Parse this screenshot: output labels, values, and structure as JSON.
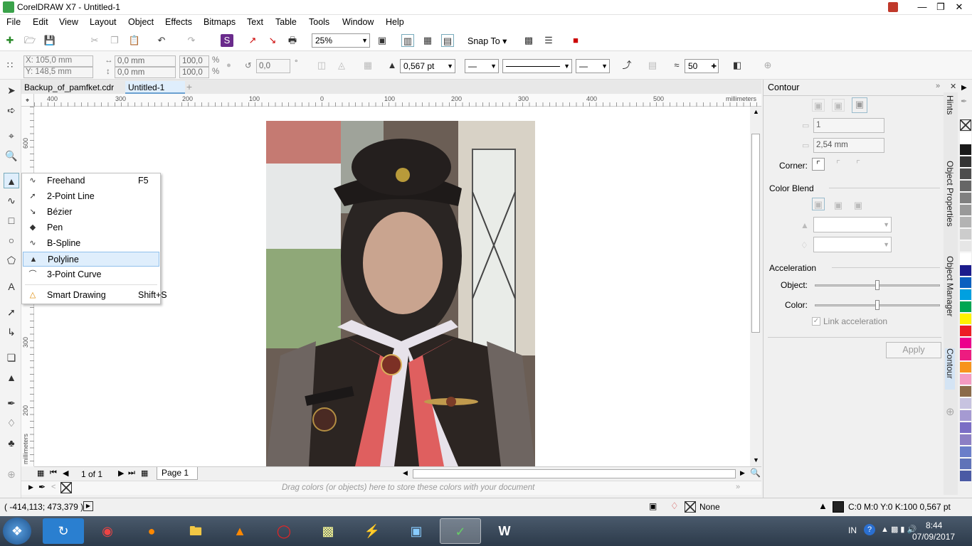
{
  "window": {
    "title": "CorelDRAW X7 - Untitled-1"
  },
  "menu": [
    "File",
    "Edit",
    "View",
    "Layout",
    "Object",
    "Effects",
    "Bitmaps",
    "Text",
    "Table",
    "Tools",
    "Window",
    "Help"
  ],
  "toolbar": {
    "zoom": "25%",
    "snap_to": "Snap To"
  },
  "props": {
    "x": "X: 105,0 mm",
    "y": "Y: 148,5 mm",
    "w": "0,0 mm",
    "h": "0,0 mm",
    "sx": "100,0",
    "sy": "100,0",
    "pct": "%",
    "angle": "0,0",
    "deg": "°",
    "outline_width": "0,567 pt",
    "smoothing": "50"
  },
  "doc_tabs": [
    "Backup_of_pamfket.cdr",
    "Untitled-1"
  ],
  "ruler": {
    "h_ticks": [
      "400",
      "300",
      "200",
      "100",
      "0",
      "100",
      "200",
      "300",
      "400",
      "500"
    ],
    "h_units": "millimeters",
    "v_ticks": [
      "600",
      "300",
      "200"
    ],
    "v_units": "millimeters"
  },
  "flyout": [
    {
      "label": "Freehand",
      "shortcut": "F5",
      "icon": "freehand-icon"
    },
    {
      "label": "2-Point Line",
      "shortcut": "",
      "icon": "two-point-line-icon"
    },
    {
      "label": "Bézier",
      "shortcut": "",
      "icon": "bezier-icon"
    },
    {
      "label": "Pen",
      "shortcut": "",
      "icon": "pen-icon"
    },
    {
      "label": "B-Spline",
      "shortcut": "",
      "icon": "bspline-icon"
    },
    {
      "label": "Polyline",
      "shortcut": "",
      "icon": "polyline-icon"
    },
    {
      "label": "3-Point Curve",
      "shortcut": "",
      "icon": "three-point-curve-icon"
    },
    {
      "label": "Smart Drawing",
      "shortcut": "Shift+S",
      "icon": "smart-drawing-icon"
    }
  ],
  "pagebar": {
    "page_count": "1 of 1",
    "page_tab": "Page 1"
  },
  "colorbar": {
    "hint": "Drag colors (or objects) here to store these colors with your document"
  },
  "docker": {
    "title": "Contour",
    "steps": "1",
    "offset": "2,54 mm",
    "corner_label": "Corner:",
    "color_blend_label": "Color Blend",
    "acceleration_label": "Acceleration",
    "object_label": "Object:",
    "color_label": "Color:",
    "object_accel": 0.5,
    "color_accel": 0.5,
    "link_accel": "Link acceleration",
    "apply": "Apply"
  },
  "docker_tabs": [
    "Hints",
    "Object Properties",
    "Object Manager",
    "Contour"
  ],
  "palette_colors": [
    "#ffffff",
    "#1a1a1a",
    "#333333",
    "#4d4d4d",
    "#666666",
    "#808080",
    "#999999",
    "#b3b3b3",
    "#cccccc",
    "#e6e6e6",
    "#ffffff",
    "#1b1b8c",
    "#0b5fbf",
    "#00a0e0",
    "#00a651",
    "#fff200",
    "#ed1c24",
    "#ec008c",
    "#ed1c80",
    "#f7941d",
    "#f49ac1",
    "#8b6b4a",
    "#c7c3e0",
    "#a59ad2",
    "#7b6ec5",
    "#8c7fc4",
    "#6a7ec9",
    "#5f73b8",
    "#4b5aa4"
  ],
  "status": {
    "coords": "( -414,113; 473,379 )",
    "fill": "None",
    "outline": "C:0 M:0 Y:0 K:100  0,567 pt"
  },
  "taskbar": {
    "lang": "IN",
    "time": "8:44",
    "date": "07/09/2017"
  }
}
